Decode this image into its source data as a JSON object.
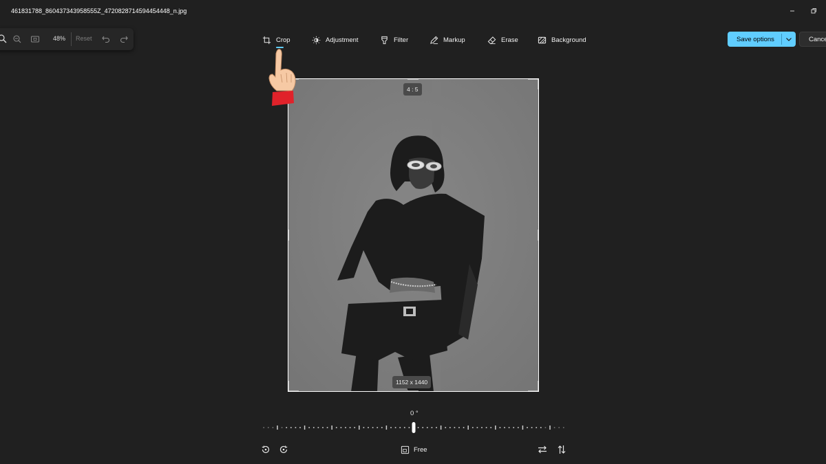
{
  "window": {
    "title": "461831788_860437343958555Z_4720828714594454448_n.jpg",
    "minimize_icon": "minimize-icon",
    "restore_icon": "restore-icon"
  },
  "zoom_toolbar": {
    "zoom_value": "48%",
    "reset_label": "Reset",
    "icons": [
      "zoom-in-icon",
      "zoom-out-icon",
      "fit-to-window-icon",
      "undo-icon",
      "redo-icon"
    ]
  },
  "tabs": [
    {
      "label": "Crop",
      "icon": "crop-icon",
      "active": true
    },
    {
      "label": "Adjustment",
      "icon": "brightness-icon",
      "active": false
    },
    {
      "label": "Filter",
      "icon": "filter-icon",
      "active": false
    },
    {
      "label": "Markup",
      "icon": "pen-icon",
      "active": false
    },
    {
      "label": "Erase",
      "icon": "eraser-icon",
      "active": false
    },
    {
      "label": "Background",
      "icon": "background-icon",
      "active": false
    }
  ],
  "actions": {
    "save_label": "Save options",
    "cancel_label": "Cancel"
  },
  "colors": {
    "accent": "#60cdff",
    "background": "#202020"
  },
  "crop": {
    "aspect_ratio": "4 : 5",
    "dimensions": "1152 x 1440",
    "angle": "0 °",
    "mode_label": "Free"
  },
  "bottom_icons": [
    "rotate-left-icon",
    "rotate-right-icon",
    "aspect-ratio-icon",
    "flip-horizontal-icon",
    "flip-vertical-icon"
  ]
}
